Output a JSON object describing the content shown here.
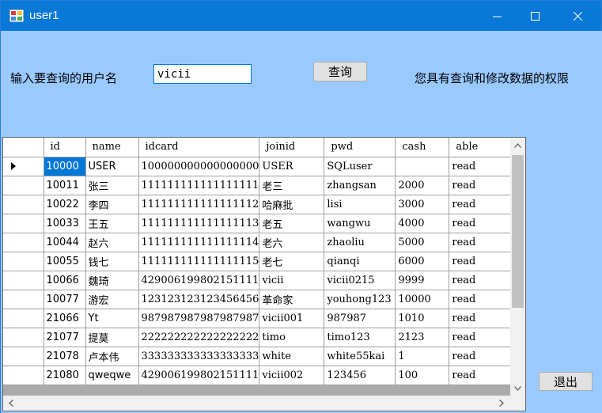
{
  "window": {
    "title": "user1"
  },
  "form": {
    "username_label": "输入要查询的用户名",
    "search_value": "vicii",
    "query_button": "查询",
    "permission_text": "您具有查询和修改数据的权限",
    "exit_button": "退出"
  },
  "grid": {
    "columns": [
      "id",
      "name",
      "idcard",
      "joinid",
      "pwd",
      "cash",
      "able"
    ],
    "rows": [
      [
        "10000",
        "USER",
        "100000000000000000",
        "USER",
        "SQLuser",
        "",
        "read"
      ],
      [
        "10011",
        "张三",
        "111111111111111111",
        "老三",
        "zhangsan",
        "2000",
        "read"
      ],
      [
        "10022",
        "李四",
        "111111111111111112",
        "哈麻批",
        "lisi",
        "3000",
        "read"
      ],
      [
        "10033",
        "王五",
        "111111111111111113",
        "老五",
        "wangwu",
        "4000",
        "read"
      ],
      [
        "10044",
        "赵六",
        "111111111111111114",
        "老六",
        "zhaoliu",
        "5000",
        "read"
      ],
      [
        "10055",
        "钱七",
        "111111111111111115",
        "老七",
        "qianqi",
        "6000",
        "read"
      ],
      [
        "10066",
        "魏琦",
        "429006199802151111",
        "vicii",
        "vicii0215",
        "9999",
        "read"
      ],
      [
        "10077",
        "游宏",
        "123123123123456456",
        "革命家",
        "youhong123",
        "10000",
        "read"
      ],
      [
        "21066",
        "Yt",
        "987987987987987987",
        "vicii001",
        "987987",
        "1010",
        "read"
      ],
      [
        "21077",
        "提莫",
        "222222222222222222",
        "timo",
        "timo123",
        "2123",
        "read"
      ],
      [
        "21078",
        "卢本伟",
        "333333333333333333",
        "white",
        "white55kai",
        "1",
        "read"
      ],
      [
        "21080",
        "qweqwe",
        "429006199802151111",
        "vicii002",
        "123456",
        "100",
        "read"
      ]
    ]
  },
  "colors": {
    "titlebar": "#0a78d7",
    "client": "#99c9ff",
    "selection": "#0078d7"
  }
}
